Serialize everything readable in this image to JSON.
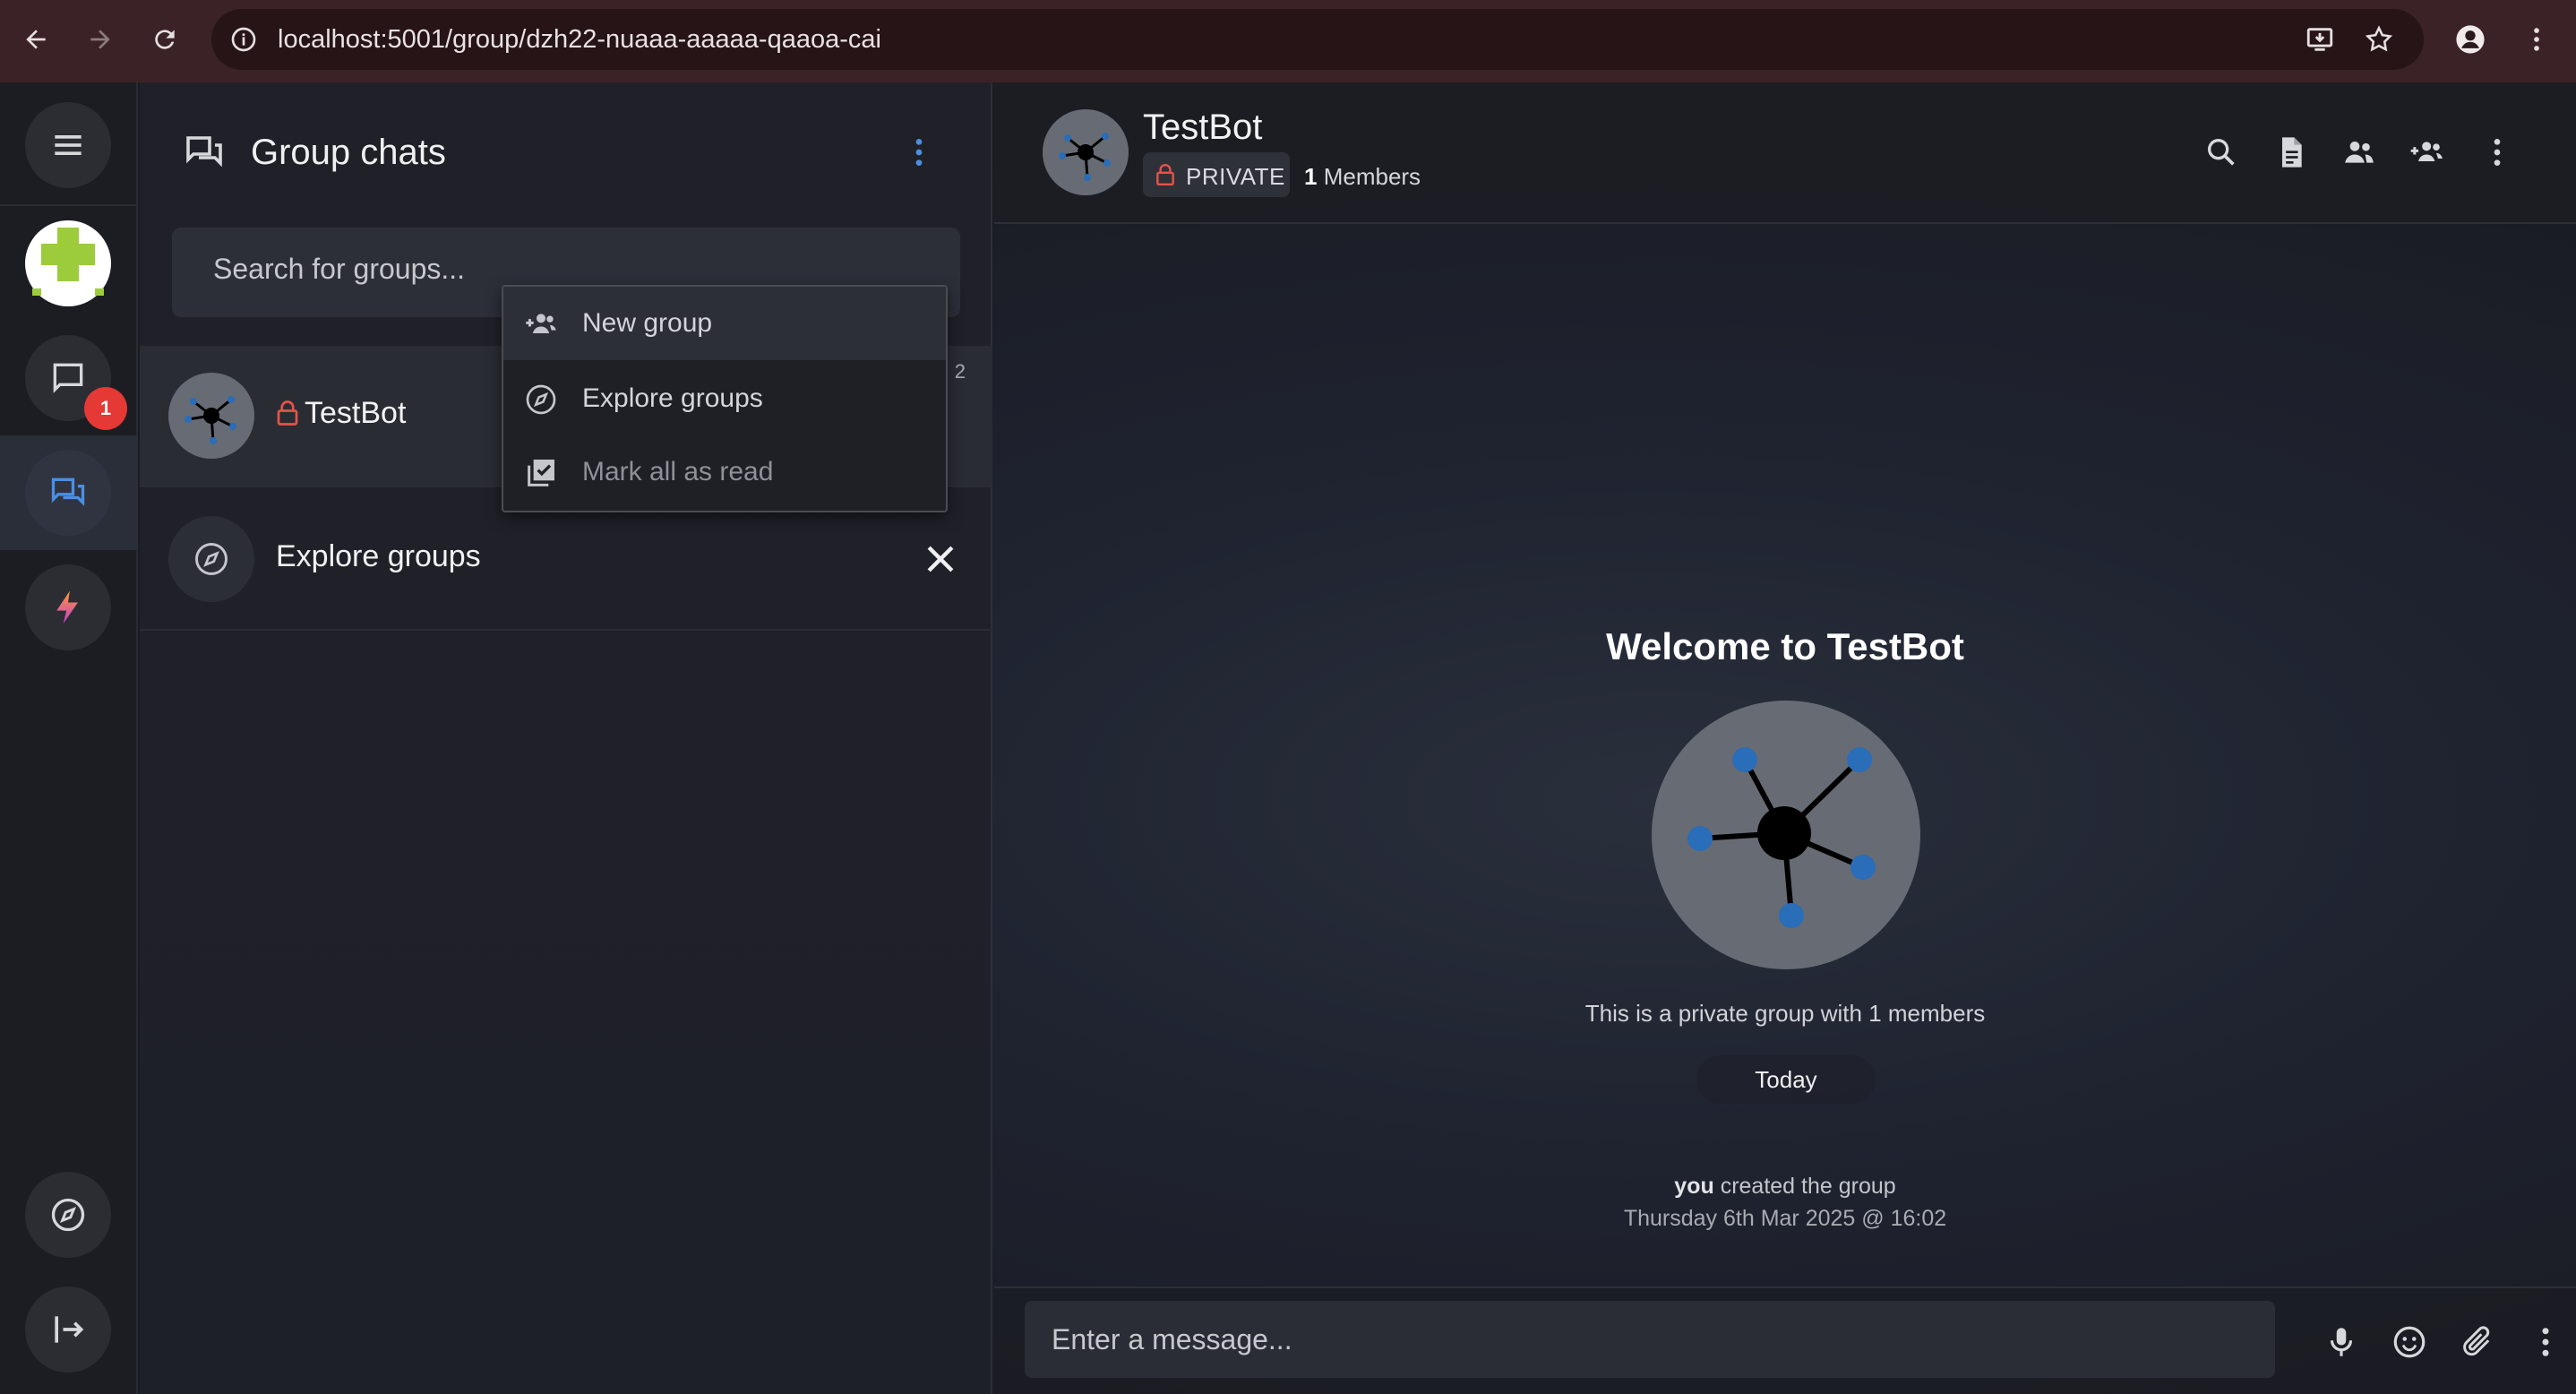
{
  "browser": {
    "url": "localhost:5001/group/dzh22-nuaaa-aaaaa-qaaoa-cai"
  },
  "rail": {
    "unread_badge": "1"
  },
  "groups_panel": {
    "title": "Group chats",
    "search_placeholder": "Search for groups...",
    "rows": [
      {
        "name": "TestBot",
        "time_fragment": "2"
      },
      {
        "name": "Explore groups"
      }
    ]
  },
  "menu": {
    "items": [
      {
        "label": "New group",
        "icon": "add-group-icon"
      },
      {
        "label": "Explore groups",
        "icon": "compass-icon"
      },
      {
        "label": "Mark all as read",
        "icon": "mark-read-icon"
      }
    ]
  },
  "chat": {
    "title": "TestBot",
    "privacy": "PRIVATE",
    "member_count": "1",
    "members_label": "Members",
    "welcome": "Welcome to TestBot",
    "private_note": "This is a private group with 1 members",
    "date_chip": "Today",
    "event_actor": "you",
    "event_text": "created the group",
    "event_time": "Thursday 6th Mar 2025 @ 16:02",
    "composer_placeholder": "Enter a message..."
  },
  "colors": {
    "accent_blue": "#4a90e2",
    "lock_red": "#e5534b",
    "badge_red": "#e53935",
    "plus_green": "#9ccc3c"
  }
}
